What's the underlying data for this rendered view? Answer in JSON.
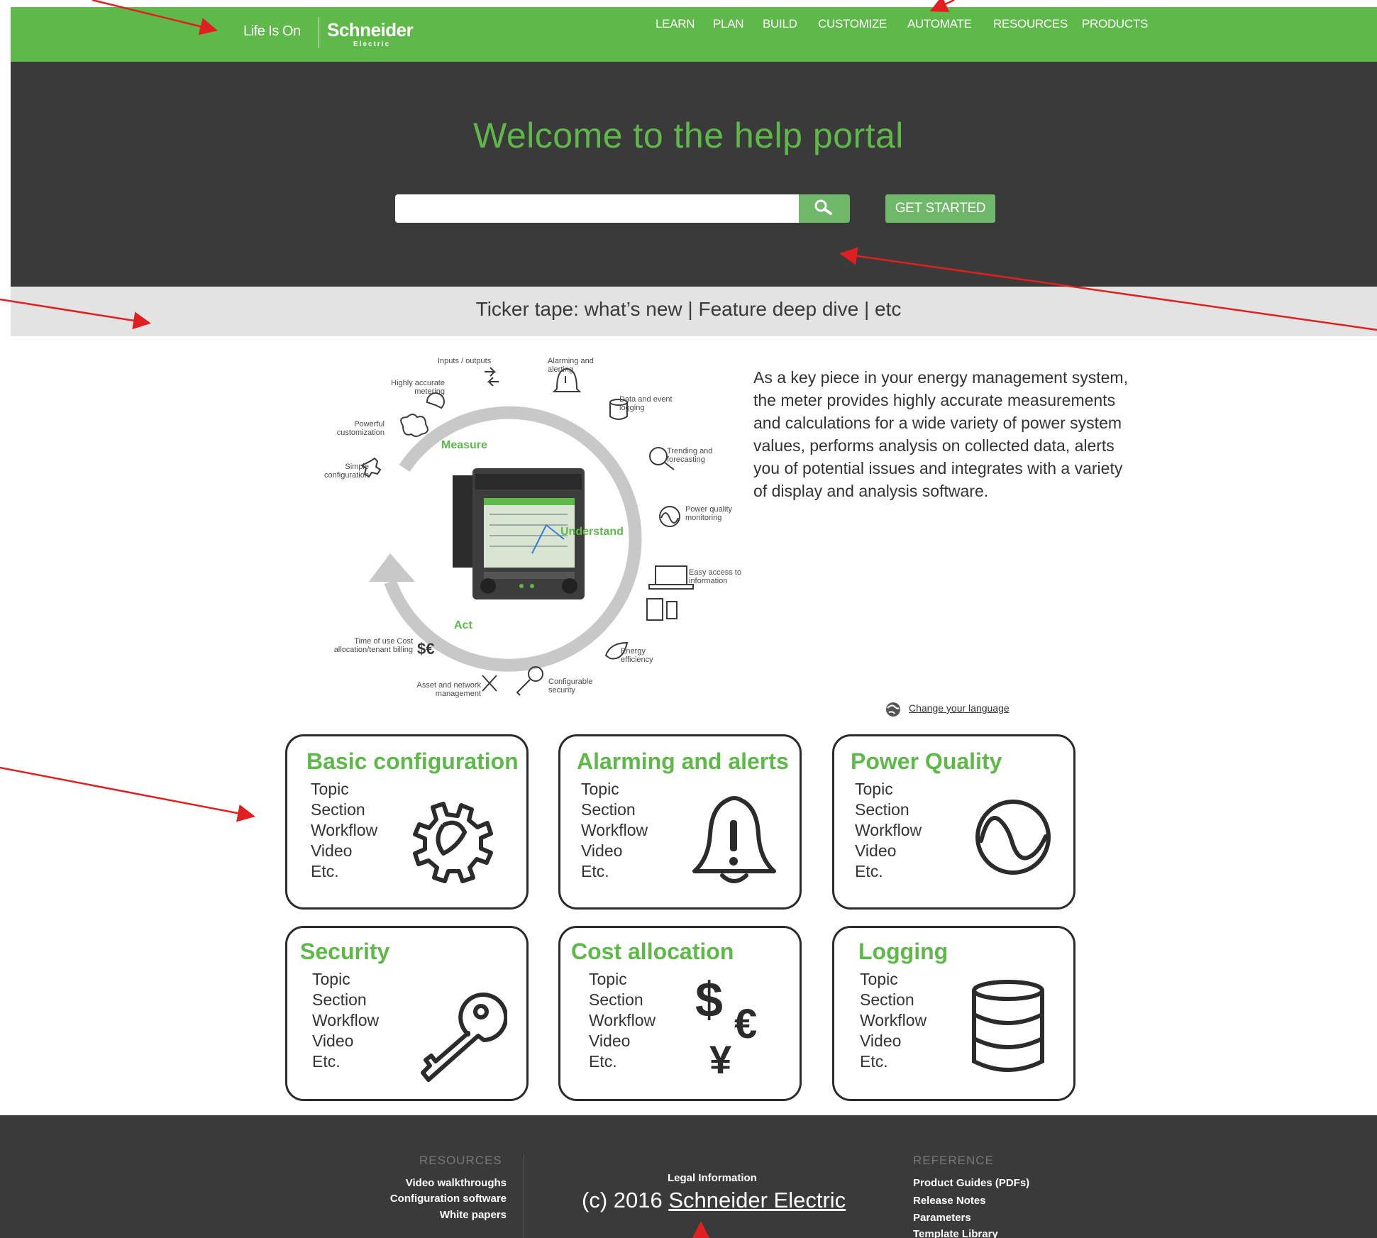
{
  "header": {
    "tagline": "Life Is On",
    "logo": "Schneider",
    "logo_sub": "Electric",
    "nav": [
      "LEARN",
      "PLAN",
      "BUILD",
      "CUSTOMIZE",
      "AUTOMATE",
      "RESOURCES",
      "PRODUCTS"
    ]
  },
  "hero": {
    "title": "Welcome to the help portal",
    "search_placeholder": "",
    "search_icon": "search-icon",
    "get_started": "GET STARTED"
  },
  "ticker": {
    "text": "Ticker tape: what’s new | Feature deep dive | etc"
  },
  "diagram": {
    "phases": [
      "Measure",
      "Understand",
      "Act"
    ],
    "features": [
      "Inputs / outputs",
      "Alarming and alerting",
      "Highly accurate metering",
      "Data and event logging",
      "Powerful customization",
      "Trending and forecasting",
      "Simple configuration",
      "Power quality monitoring",
      "Easy access to information",
      "Time of use Cost allocation/tenant billing",
      "Energy efficiency",
      "Asset and network management",
      "Configurable security"
    ]
  },
  "intro": "As a key piece in your energy management system, the meter provides highly accurate measurements and calculations for a wide variety of power system values, performs analysis on collected data, alerts you of potential issues and integrates with a variety of display and analysis software.",
  "language_link": "Change your language",
  "cards": [
    {
      "title": "Basic configuration",
      "items": [
        "Topic",
        "Section",
        "Workflow",
        "Video",
        "Etc."
      ],
      "icon": "gear-icon"
    },
    {
      "title": "Alarming and alerts",
      "items": [
        "Topic",
        "Section",
        "Workflow",
        "Video",
        "Etc."
      ],
      "icon": "bell-icon"
    },
    {
      "title": "Power Quality",
      "items": [
        "Topic",
        "Section",
        "Workflow",
        "Video",
        "Etc."
      ],
      "icon": "waveform-icon"
    },
    {
      "title": "Security",
      "items": [
        "Topic",
        "Section",
        "Workflow",
        "Video",
        "Etc."
      ],
      "icon": "key-icon"
    },
    {
      "title": "Cost allocation",
      "items": [
        "Topic",
        "Section",
        "Workflow",
        "Video",
        "Etc."
      ],
      "icon": "currency-icon"
    },
    {
      "title": "Logging",
      "items": [
        "Topic",
        "Section",
        "Workflow",
        "Video",
        "Etc."
      ],
      "icon": "database-icon"
    }
  ],
  "footer": {
    "resources_heading": "RESOURCES",
    "resources": [
      "Video walkthroughs",
      "Configuration software",
      "White papers"
    ],
    "legal": "Legal Information",
    "copyright_prefix": "(c) 2016 ",
    "copyright_link": "Schneider Electric",
    "reference_heading": "REFERENCE",
    "reference": [
      "Product Guides (PDFs)",
      "Release Notes",
      "Parameters",
      "Template Library"
    ]
  },
  "colors": {
    "brand_green": "#5fb84a",
    "hero_bg": "#3a3a3a",
    "ticker_bg": "#e3e3e3",
    "annotation_red": "#e02020"
  }
}
